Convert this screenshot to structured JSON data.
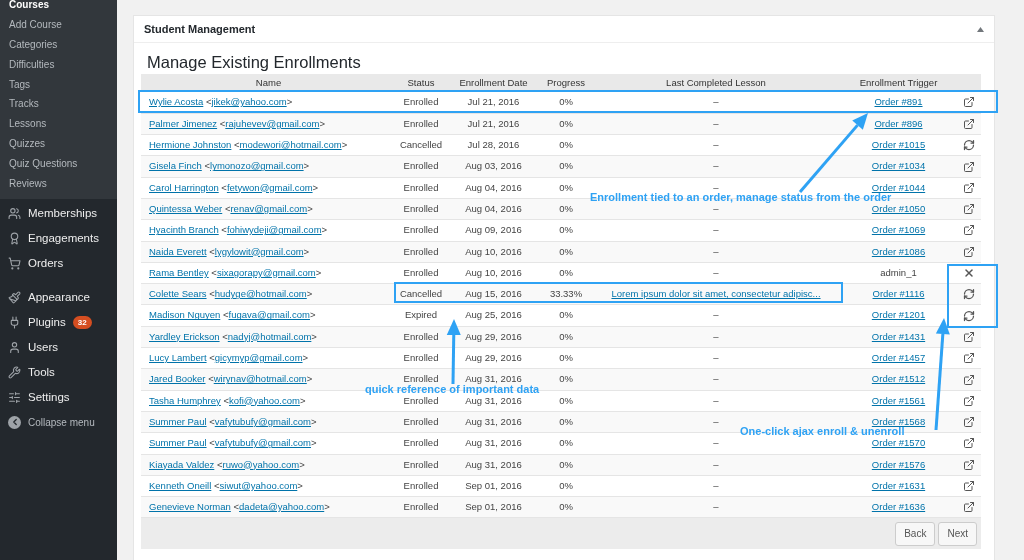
{
  "sidebar": {
    "submenu": [
      {
        "label": "Courses",
        "selected": true
      },
      {
        "label": "Add Course",
        "selected": false
      },
      {
        "label": "Categories",
        "selected": false
      },
      {
        "label": "Difficulties",
        "selected": false
      },
      {
        "label": "Tags",
        "selected": false
      },
      {
        "label": "Tracks",
        "selected": false
      },
      {
        "label": "Lessons",
        "selected": false
      },
      {
        "label": "Quizzes",
        "selected": false
      },
      {
        "label": "Quiz Questions",
        "selected": false
      },
      {
        "label": "Reviews",
        "selected": false
      }
    ],
    "groups": [
      [
        {
          "label": "Memberships"
        },
        {
          "label": "Engagements"
        },
        {
          "label": "Orders"
        }
      ],
      [
        {
          "label": "Appearance"
        },
        {
          "label": "Plugins",
          "badge": "32"
        },
        {
          "label": "Users"
        },
        {
          "label": "Tools"
        },
        {
          "label": "Settings"
        }
      ]
    ],
    "collapse": "Collapse menu"
  },
  "panel": {
    "title": "Student Management",
    "heading": "Manage Existing Enrollments",
    "columns": [
      "Name",
      "Status",
      "Enrollment Date",
      "Progress",
      "Last Completed Lesson",
      "Enrollment Trigger"
    ],
    "rows": [
      {
        "name": "Wylie Acosta",
        "email": "jikek@yahoo.com",
        "status": "Enrolled",
        "date": "Jul 21, 2016",
        "progress": "0%",
        "lesson": "–",
        "lesson_link": false,
        "trigger": "Order #891",
        "trigger_link": true,
        "kind": "open"
      },
      {
        "name": "Palmer Jimenez",
        "email": "rajuhevev@gmail.com",
        "status": "Enrolled",
        "date": "Jul 21, 2016",
        "progress": "0%",
        "lesson": "–",
        "lesson_link": false,
        "trigger": "Order #896",
        "trigger_link": true,
        "kind": "open"
      },
      {
        "name": "Hermione Johnston",
        "email": "modewori@hotmail.com",
        "status": "Cancelled",
        "date": "Jul 28, 2016",
        "progress": "0%",
        "lesson": "–",
        "lesson_link": false,
        "trigger": "Order #1015",
        "trigger_link": true,
        "kind": "sync"
      },
      {
        "name": "Gisela Finch",
        "email": "lymonozo@gmail.com",
        "status": "Enrolled",
        "date": "Aug 03, 2016",
        "progress": "0%",
        "lesson": "–",
        "lesson_link": false,
        "trigger": "Order #1034",
        "trigger_link": true,
        "kind": "open"
      },
      {
        "name": "Carol Harrington",
        "email": "fetywon@gmail.com",
        "status": "Enrolled",
        "date": "Aug 04, 2016",
        "progress": "0%",
        "lesson": "–",
        "lesson_link": false,
        "trigger": "Order #1044",
        "trigger_link": true,
        "kind": "open"
      },
      {
        "name": "Quintessa Weber",
        "email": "renav@gmail.com",
        "status": "Enrolled",
        "date": "Aug 04, 2016",
        "progress": "0%",
        "lesson": "–",
        "lesson_link": false,
        "trigger": "Order #1050",
        "trigger_link": true,
        "kind": "open"
      },
      {
        "name": "Hyacinth Branch",
        "email": "fohiwydeji@gmail.com",
        "status": "Enrolled",
        "date": "Aug 09, 2016",
        "progress": "0%",
        "lesson": "–",
        "lesson_link": false,
        "trigger": "Order #1069",
        "trigger_link": true,
        "kind": "open"
      },
      {
        "name": "Naida Everett",
        "email": "lygylowit@gmail.com",
        "status": "Enrolled",
        "date": "Aug 10, 2016",
        "progress": "0%",
        "lesson": "–",
        "lesson_link": false,
        "trigger": "Order #1086",
        "trigger_link": true,
        "kind": "open"
      },
      {
        "name": "Rama Bentley",
        "email": "sixagorapy@gmail.com",
        "status": "Enrolled",
        "date": "Aug 10, 2016",
        "progress": "0%",
        "lesson": "–",
        "lesson_link": false,
        "trigger": "admin_1",
        "trigger_link": false,
        "kind": "remove"
      },
      {
        "name": "Colette Sears",
        "email": "hudyge@hotmail.com",
        "status": "Cancelled",
        "date": "Aug 15, 2016",
        "progress": "33.33%",
        "lesson": "Lorem ipsum dolor sit amet, consectetur adipisc...",
        "lesson_link": true,
        "trigger": "Order #1116",
        "trigger_link": true,
        "kind": "sync"
      },
      {
        "name": "Madison Nguyen",
        "email": "fugava@gmail.com",
        "status": "Expired",
        "date": "Aug 25, 2016",
        "progress": "0%",
        "lesson": "–",
        "lesson_link": false,
        "trigger": "Order #1201",
        "trigger_link": true,
        "kind": "sync"
      },
      {
        "name": "Yardley Erickson",
        "email": "nadyj@hotmail.com",
        "status": "Enrolled",
        "date": "Aug 29, 2016",
        "progress": "0%",
        "lesson": "–",
        "lesson_link": false,
        "trigger": "Order #1431",
        "trigger_link": true,
        "kind": "open"
      },
      {
        "name": "Lucy Lambert",
        "email": "gicymyp@gmail.com",
        "status": "Enrolled",
        "date": "Aug 29, 2016",
        "progress": "0%",
        "lesson": "–",
        "lesson_link": false,
        "trigger": "Order #1457",
        "trigger_link": true,
        "kind": "open"
      },
      {
        "name": "Jared Booker",
        "email": "wirynav@hotmail.com",
        "status": "Enrolled",
        "date": "Aug 31, 2016",
        "progress": "0%",
        "lesson": "–",
        "lesson_link": false,
        "trigger": "Order #1512",
        "trigger_link": true,
        "kind": "open"
      },
      {
        "name": "Tasha Humphrey",
        "email": "kofi@yahoo.com",
        "status": "Enrolled",
        "date": "Aug 31, 2016",
        "progress": "0%",
        "lesson": "–",
        "lesson_link": false,
        "trigger": "Order #1561",
        "trigger_link": true,
        "kind": "open"
      },
      {
        "name": "Summer Paul",
        "email": "vafytubufy@gmail.com",
        "status": "Enrolled",
        "date": "Aug 31, 2016",
        "progress": "0%",
        "lesson": "–",
        "lesson_link": false,
        "trigger": "Order #1568",
        "trigger_link": true,
        "kind": "open"
      },
      {
        "name": "Summer Paul",
        "email": "vafytubufy@gmail.com",
        "status": "Enrolled",
        "date": "Aug 31, 2016",
        "progress": "0%",
        "lesson": "–",
        "lesson_link": false,
        "trigger": "Order #1570",
        "trigger_link": true,
        "kind": "open"
      },
      {
        "name": "Kiayada Valdez",
        "email": "ruwo@yahoo.com",
        "status": "Enrolled",
        "date": "Aug 31, 2016",
        "progress": "0%",
        "lesson": "–",
        "lesson_link": false,
        "trigger": "Order #1576",
        "trigger_link": true,
        "kind": "open"
      },
      {
        "name": "Kenneth Oneill",
        "email": "siwut@yahoo.com",
        "status": "Enrolled",
        "date": "Sep 01, 2016",
        "progress": "0%",
        "lesson": "–",
        "lesson_link": false,
        "trigger": "Order #1631",
        "trigger_link": true,
        "kind": "open"
      },
      {
        "name": "Genevieve Norman",
        "email": "dadeta@yahoo.com",
        "status": "Enrolled",
        "date": "Sep 01, 2016",
        "progress": "0%",
        "lesson": "–",
        "lesson_link": false,
        "trigger": "Order #1636",
        "trigger_link": true,
        "kind": "open"
      }
    ],
    "email_open": "<",
    "email_close": ">",
    "buttons": [
      "Back",
      "Next"
    ]
  },
  "annotations": [
    "Enrollment tied to an order, manage status from the order",
    "quick reference of important data",
    "One-click ajax enroll & unenroll"
  ]
}
